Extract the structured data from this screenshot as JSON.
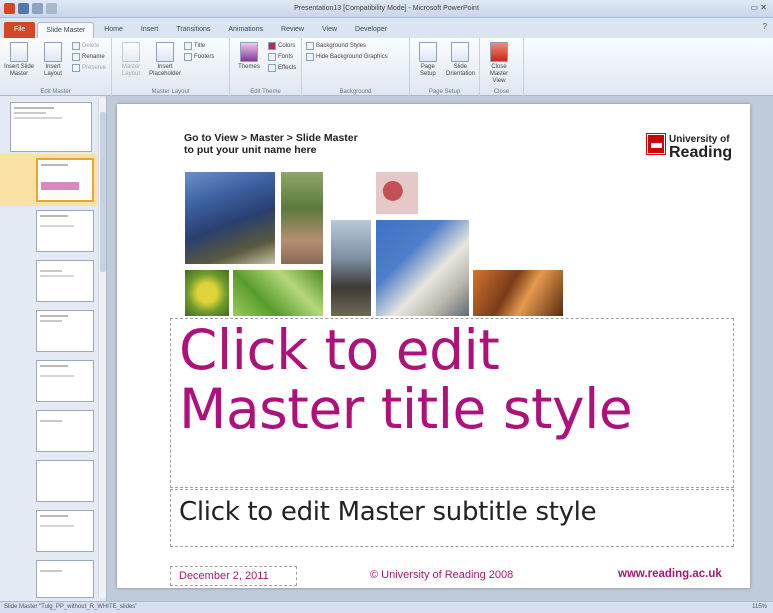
{
  "window": {
    "title": "Presentation13 [Compatibility Mode] - Microsoft PowerPoint",
    "controls": "▭ ✕"
  },
  "tabs": [
    {
      "label": "File"
    },
    {
      "label": "Slide Master"
    },
    {
      "label": "Home"
    },
    {
      "label": "Insert"
    },
    {
      "label": "Transitions"
    },
    {
      "label": "Animations"
    },
    {
      "label": "Review"
    },
    {
      "label": "View"
    },
    {
      "label": "Developer"
    }
  ],
  "ribbon": {
    "edit_master": {
      "label": "Edit Master",
      "insert_slide_master": "Insert Slide Master",
      "insert_layout": "Insert Layout",
      "delete": "Delete",
      "rename": "Rename",
      "preserve": "Preserve"
    },
    "master_layout": {
      "label": "Master Layout",
      "master_layout_btn": "Master Layout",
      "insert_placeholder": "Insert Placeholder",
      "title": "Title",
      "footers": "Footers"
    },
    "edit_theme": {
      "label": "Edit Theme",
      "themes": "Themes",
      "colors": "Colors",
      "fonts": "Fonts",
      "effects": "Effects"
    },
    "background": {
      "label": "Background",
      "background_styles": "Background Styles",
      "hide_background": "Hide Background Graphics"
    },
    "page_setup": {
      "label": "Page Setup",
      "page_setup_btn": "Page Setup",
      "slide_orientation": "Slide Orientation"
    },
    "close": {
      "label": "Close",
      "close_master": "Close Master View"
    }
  },
  "slide": {
    "instruction_line1": "Go to View > Master > Slide Master",
    "instruction_line2": "to put your unit name here",
    "logo_line1": "University of",
    "logo_line2": "Reading",
    "title_line1": "Click to edit",
    "title_line2": "Master title style",
    "subtitle": "Click to edit Master subtitle style",
    "footer_date": "December 2, 2011",
    "footer_copyright": "© University of Reading 2008",
    "footer_url": "www.reading.ac.uk"
  },
  "status": {
    "left": "Slide Master   \"Tulg_PP_without_R_WHITE_slides\"",
    "zoom": "115%"
  }
}
